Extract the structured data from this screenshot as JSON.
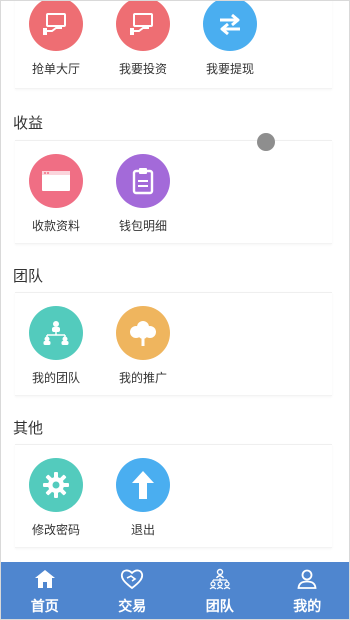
{
  "colors": {
    "red": "#ee6e73",
    "blue": "#4aaef0",
    "pink": "#f06e84",
    "purple": "#a36ad9",
    "teal": "#53cbbd",
    "orange": "#efb55e",
    "tabbar": "#4f86cf"
  },
  "top_row": [
    {
      "label": "抢单大厅",
      "icon": "monitor-hand-icon",
      "color": "red"
    },
    {
      "label": "我要投资",
      "icon": "monitor-hand-icon",
      "color": "red"
    },
    {
      "label": "我要提现",
      "icon": "swap-arrows-icon",
      "color": "blue"
    }
  ],
  "sections": [
    {
      "title": "收益",
      "items": [
        {
          "label": "收款资料",
          "icon": "browser-window-icon",
          "color": "pink"
        },
        {
          "label": "钱包明细",
          "icon": "clipboard-icon",
          "color": "purple"
        }
      ]
    },
    {
      "title": "团队",
      "items": [
        {
          "label": "我的团队",
          "icon": "team-tree-icon",
          "color": "teal"
        },
        {
          "label": "我的推广",
          "icon": "cotton-flower-icon",
          "color": "orange"
        }
      ]
    },
    {
      "title": "其他",
      "items": [
        {
          "label": "修改密码",
          "icon": "gear-icon",
          "color": "teal"
        },
        {
          "label": "退出",
          "icon": "arrow-up-icon",
          "color": "blue"
        }
      ]
    }
  ],
  "tabbar": [
    {
      "label": "首页",
      "icon": "home-icon"
    },
    {
      "label": "交易",
      "icon": "handshake-icon"
    },
    {
      "label": "团队",
      "icon": "team-tree-icon"
    },
    {
      "label": "我的",
      "icon": "user-icon"
    }
  ]
}
